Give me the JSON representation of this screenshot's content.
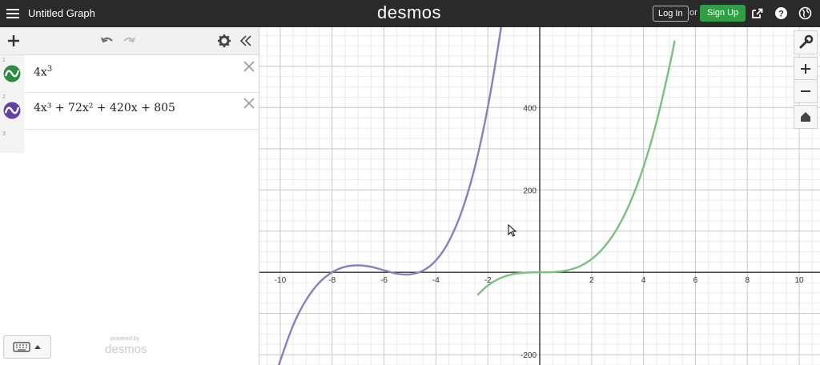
{
  "header": {
    "graph_title": "Untitled Graph",
    "logo": "desmos",
    "login_label": "Log In",
    "or_label": "or",
    "signup_label": "Sign Up",
    "icons": [
      "menu-icon",
      "share-icon",
      "help-icon",
      "language-globe-icon"
    ]
  },
  "sidebar": {
    "toolbar_icons": [
      "add-icon",
      "undo-icon",
      "redo-icon",
      "settings-gear-icon",
      "collapse-chevrons-icon"
    ],
    "expressions": [
      {
        "index": "1",
        "latex_parts": [
          "4x",
          "3"
        ],
        "color": "#2d8a3e"
      },
      {
        "index": "2",
        "latex_text": "4x³ + 72x² + 420x + 805",
        "color": "#6042a6"
      }
    ],
    "empty_index": "3",
    "footer": {
      "powered_by": "powered by",
      "logo": "desmos"
    }
  },
  "graph_controls": [
    "wrench-icon",
    "zoom-in-icon",
    "zoom-out-icon",
    "home-icon"
  ],
  "chart_data": {
    "type": "line",
    "x_ticks": [
      "-10",
      "-8",
      "-6",
      "-4",
      "-2",
      "2",
      "4",
      "6",
      "8",
      "10"
    ],
    "y_ticks": [
      "400",
      "200",
      "-200"
    ],
    "xlim": [
      -10.8,
      10.8
    ],
    "ylim": [
      -225,
      595
    ],
    "grid": true,
    "series": [
      {
        "expression": "4x^3",
        "color": "#7ac07f",
        "x": [
          -2.4,
          -2,
          -1.5,
          -1,
          -0.5,
          0,
          0.5,
          1,
          1.5,
          2,
          2.5,
          3,
          3.5,
          4,
          4.5,
          5,
          5.2
        ],
        "y": [
          -55.3,
          -32,
          -13.5,
          -4,
          -0.5,
          0,
          0.5,
          4,
          13.5,
          32,
          62.5,
          108,
          171.5,
          256,
          364.5,
          500,
          562.4
        ]
      },
      {
        "expression": "4x^3+72x^2+420x+805",
        "color": "#8f7cc0",
        "x": [
          -10.2,
          -10,
          -9.5,
          -9,
          -8.5,
          -8,
          -7.5,
          -7,
          -6.5,
          -6,
          -5.5,
          -5,
          -4.5,
          -4,
          -3.5,
          -3,
          -2.5,
          -2,
          -1.5,
          -1.2
        ],
        "y": [
          -254.3,
          -215,
          -128.5,
          -67,
          -25.5,
          0,
          13.5,
          17,
          13.5,
          5,
          -3.5,
          -5,
          4,
          29,
          75.5,
          149,
          255.5,
          401,
          590.5,
          730.9
        ]
      }
    ]
  }
}
